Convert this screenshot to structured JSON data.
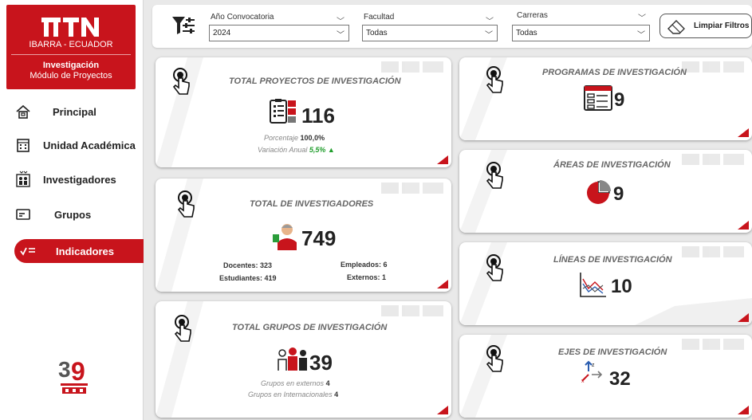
{
  "sidebar": {
    "logo": {
      "text": "UTN",
      "location": "IBARRA - ECUADOR",
      "title": "Investigación",
      "subtitle": "Módulo de Proyectos"
    },
    "items": [
      {
        "label": "Principal",
        "icon": "home-icon"
      },
      {
        "label": "Unidad Académica",
        "icon": "building-icon"
      },
      {
        "label": "Investigadores",
        "icon": "people-icon"
      },
      {
        "label": "Grupos",
        "icon": "card-icon"
      },
      {
        "label": "Indicadores",
        "icon": "indicators-icon"
      }
    ],
    "active_item": "Indicadores",
    "anniversary": {
      "number": "39",
      "text": "UTN"
    }
  },
  "filters": {
    "anio": {
      "label": "Año Convocatoria",
      "value": "2024"
    },
    "facultad": {
      "label": "Facultad",
      "value": "Todas"
    },
    "carreras": {
      "label": "Carreras",
      "value": "Todas"
    },
    "clear_label": "Limpiar Filtros"
  },
  "cards": {
    "proyectos": {
      "title": "TOTAL PROYECTOS DE INVESTIGACIÓN",
      "value": "116",
      "porcentaje_label": "Porcentaje",
      "porcentaje_value": "100,0%",
      "variacion_label": "Variación Anual",
      "variacion_value": "5,5%",
      "variacion_arrow": "▲"
    },
    "investigadores": {
      "title": "TOTAL DE INVESTIGADORES",
      "value": "749",
      "docentes_label": "Docentes:",
      "docentes_value": "323",
      "estudiantes_label": "Estudiantes:",
      "estudiantes_value": "419",
      "empleados_label": "Empleados:",
      "empleados_value": "6",
      "externos_label": "Externos:",
      "externos_value": "1"
    },
    "grupos": {
      "title": "TOTAL GRUPOS DE INVESTIGACIÓN",
      "value": "39",
      "externos_label": "Grupos en externos",
      "externos_value": "4",
      "internacionales_label": "Grupos en Internacionales",
      "internacionales_value": "4"
    },
    "programas": {
      "title": "PROGRAMAS DE INVESTIGACIÓN",
      "value": "9"
    },
    "areas": {
      "title": "ÁREAS DE INVESTIGACIÓN",
      "value": "9"
    },
    "lineas": {
      "title": "LÍNEAS DE INVESTIGACIÓN",
      "value": "10"
    },
    "ejes": {
      "title": "EJES DE INVESTIGACIÓN",
      "value": "32"
    }
  },
  "colors": {
    "brand_red": "#c8141c",
    "positive_green": "#1f9d2b"
  }
}
